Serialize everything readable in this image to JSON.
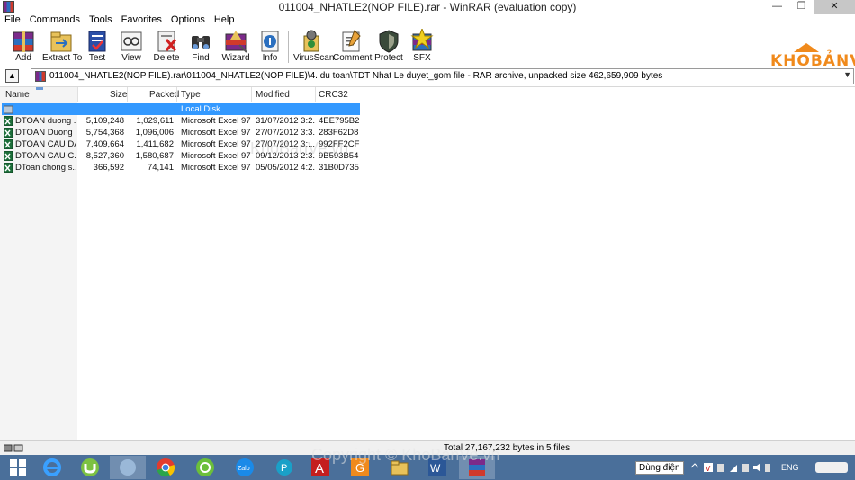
{
  "window": {
    "title": "011004_NHATLE2(NOP FILE).rar - WinRAR (evaluation copy)",
    "minimize": "—",
    "restore": "❐",
    "close": "✕"
  },
  "menu": [
    "File",
    "Commands",
    "Tools",
    "Favorites",
    "Options",
    "Help"
  ],
  "toolbar": [
    {
      "label": "Add",
      "icon": "add-icon"
    },
    {
      "label": "Extract To",
      "icon": "extract-to-icon"
    },
    {
      "label": "Test",
      "icon": "test-icon"
    },
    {
      "label": "View",
      "icon": "view-icon"
    },
    {
      "label": "Delete",
      "icon": "delete-icon"
    },
    {
      "label": "Find",
      "icon": "find-icon"
    },
    {
      "label": "Wizard",
      "icon": "wizard-icon"
    },
    {
      "label": "Info",
      "icon": "info-icon"
    },
    {
      "label": "VirusScan",
      "icon": "virusscan-icon"
    },
    {
      "label": "Comment",
      "icon": "comment-icon"
    },
    {
      "label": "Protect",
      "icon": "protect-icon"
    },
    {
      "label": "SFX",
      "icon": "sfx-icon"
    }
  ],
  "logo": "KHOBẢNVẼ",
  "address": {
    "path": "011004_NHATLE2(NOP FILE).rar\\011004_NHATLE2(NOP FILE)\\4. du toan\\TDT Nhat Le duyet_gom file - RAR archive, unpacked size 462,659,909 bytes"
  },
  "columns": {
    "name": "Name",
    "size": "Size",
    "packed": "Packed",
    "type": "Type",
    "modified": "Modified",
    "crc": "CRC32"
  },
  "files": [
    {
      "name": "..",
      "size": "",
      "packed": "",
      "type": "Local Disk",
      "modified": "",
      "crc": ""
    },
    {
      "name": "DTOAN duong ...",
      "size": "5,109,248",
      "packed": "1,029,611",
      "type": "Microsoft Excel 97...",
      "modified": "31/07/2012 3:2...",
      "crc": "4EE795B2"
    },
    {
      "name": "DTOAN Duong ...",
      "size": "5,754,368",
      "packed": "1,096,006",
      "type": "Microsoft Excel 97...",
      "modified": "27/07/2012 3:3...",
      "crc": "283F62D8"
    },
    {
      "name": "DTOAN CAU DA...",
      "size": "7,409,664",
      "packed": "1,411,682",
      "type": "Microsoft Excel 97...",
      "modified": "27/07/2012 3:...",
      "crc": "992FF2CF"
    },
    {
      "name": "DTOAN CAU C...",
      "size": "8,527,360",
      "packed": "1,580,687",
      "type": "Microsoft Excel 97...",
      "modified": "09/12/2013 2:3...",
      "crc": "9B593B54"
    },
    {
      "name": "DToan  chong s...",
      "size": "366,592",
      "packed": "74,141",
      "type": "Microsoft Excel 97...",
      "modified": "05/05/2012 4:2...",
      "crc": "31B0D735"
    }
  ],
  "status": {
    "text": "Total 27,167,232 bytes in 5 files"
  },
  "taskbar": {
    "apps": [
      "windows-start",
      "internet-explorer",
      "utorrent",
      "app-generic",
      "chrome",
      "app-green",
      "zalo",
      "app-p",
      "autocad",
      "app-g",
      "file-explorer",
      "word",
      "winrar"
    ],
    "language": "Dùng điện",
    "input_lang": "ENG"
  },
  "watermarks": [
    "KhoBanVe.vn",
    "Copyright © KhoBanVe.vn"
  ]
}
